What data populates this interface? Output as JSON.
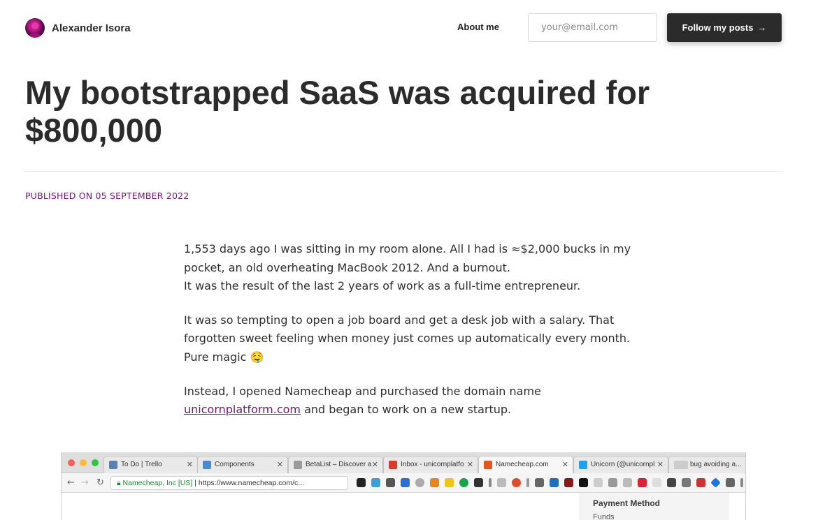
{
  "header": {
    "author_name": "Alexander Isora",
    "about_link": "About me",
    "email_placeholder": "your@email.com",
    "follow_button": "Follow my posts",
    "follow_arrow": "→"
  },
  "post": {
    "title": "My bootstrapped SaaS was acquired for $800,000",
    "published": "PUBLISHED ON 05 SEPTEMBER 2022",
    "paragraphs": {
      "p1_line1": "1,553 days ago I was sitting in my room alone. All I had is ≈$2,000 bucks in my pocket, an old overheating MacBook 2012. And a burnout.",
      "p1_line2": "It was the result of the last 2 years of work as a full-time entrepreneur.",
      "p2": "It was so tempting to open a job board and get a desk job with a salary. That forgotten sweet feeling when money just comes up automatically every month. Pure magic 🤤",
      "p3_before": "Instead, I opened Namecheap and purchased the domain name ",
      "p3_link": "unicornplatform.com",
      "p3_after": " and began to work on a new startup."
    }
  },
  "screenshot": {
    "tabs": [
      {
        "label": "To Do | Trello",
        "icon": "trello-icon",
        "color": "#5a7fb0"
      },
      {
        "label": "Components",
        "icon": "plane-icon",
        "color": "#4a8bd0"
      },
      {
        "label": "BetaList – Discover a",
        "icon": "document-icon",
        "color": "#9a9a9a"
      },
      {
        "label": "Inbox - unicornplatfo",
        "icon": "gmail-icon",
        "color": "#d93a2b"
      },
      {
        "label": "Namecheap.com",
        "icon": "namecheap-icon",
        "color": "#e8531e"
      },
      {
        "label": "Unicorn (@unicornpl",
        "icon": "twitter-icon",
        "color": "#1da1f2"
      },
      {
        "label": "bug avoiding a...",
        "icon": "blank-tab-icon",
        "color": "#cccccc"
      }
    ],
    "secure_label": "Namecheap, Inc [US]",
    "url": "https://www.namecheap.com/c...",
    "panel_title": "Payment Method",
    "panel_sub": "Funds",
    "colors": {
      "close": "#fc5f57",
      "minimize": "#fdbc2e",
      "maximize": "#28c840"
    }
  }
}
